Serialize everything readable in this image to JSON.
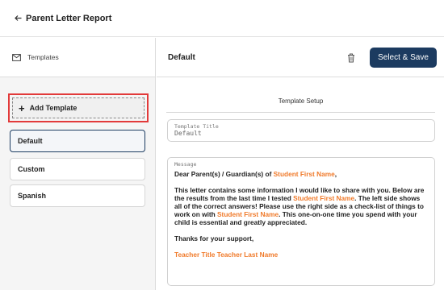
{
  "header": {
    "title": "Parent Letter Report",
    "back_icon": "arrow-left-icon"
  },
  "sidebar": {
    "header_label": "Templates",
    "header_icon": "mail-icon",
    "add_button_label": "Add Template",
    "items": [
      {
        "label": "Default",
        "selected": true
      },
      {
        "label": "Custom",
        "selected": false
      },
      {
        "label": "Spanish",
        "selected": false
      }
    ]
  },
  "editor": {
    "current_template": "Default",
    "save_label": "Select & Save",
    "delete_icon": "trash-icon",
    "section_title": "Template Setup",
    "title_field": {
      "label": "Template Title",
      "value": "Default"
    },
    "message_field": {
      "label": "Message",
      "greeting_prefix": "Dear Parent(s) / Guardian(s) of ",
      "token_student_first_name": "Student First Name",
      "greeting_suffix": ",",
      "para1_a": "This letter contains some information I would like to share with you. Below are the results from the last time I tested ",
      "para1_b": ".  The left side shows all of the correct answers!  Please use the right side as a check-list of things to work on with ",
      "para1_c": ".  This one-on-one time you spend with your child is essential and greatly appreciated.",
      "closing": "Thanks for your support,",
      "token_signature": "Teacher Title Teacher Last Name"
    }
  },
  "colors": {
    "primary": "#1c3b60",
    "token": "#f07a2a",
    "highlight": "#e23a3a"
  }
}
